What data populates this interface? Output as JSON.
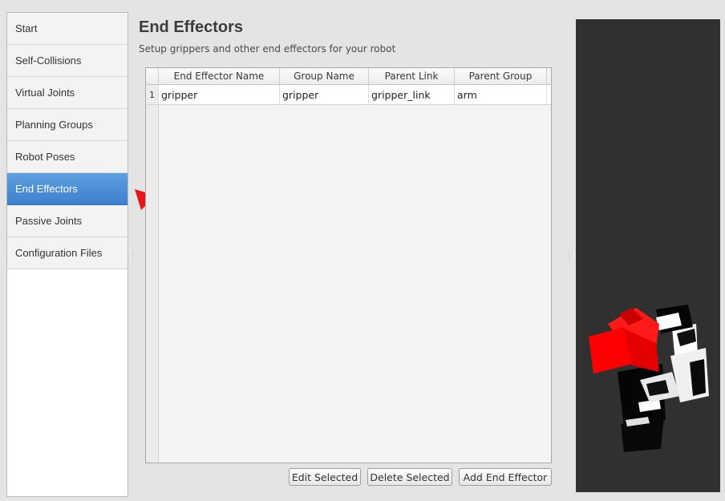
{
  "sidebar": {
    "items": [
      {
        "label": "Start"
      },
      {
        "label": "Self-Collisions"
      },
      {
        "label": "Virtual Joints"
      },
      {
        "label": "Planning Groups"
      },
      {
        "label": "Robot Poses"
      },
      {
        "label": "End Effectors",
        "active": true
      },
      {
        "label": "Passive Joints"
      },
      {
        "label": "Configuration Files"
      }
    ]
  },
  "main": {
    "title": "End Effectors",
    "subtitle": "Setup grippers and other end effectors for your robot",
    "table": {
      "columns": [
        "End Effector Name",
        "Group Name",
        "Parent Link",
        "Parent Group"
      ],
      "rows": [
        {
          "num": "1",
          "cells": [
            "gripper",
            "gripper",
            "gripper_link",
            "arm"
          ]
        }
      ]
    },
    "buttons": {
      "edit": "Edit Selected",
      "delete": "Delete Selected",
      "add": "Add End Effector"
    }
  },
  "colors": {
    "active_item": "#4a8ad6",
    "arrow": "#e8161b",
    "viewer_bg": "#303030",
    "robot_red": "#ff0000"
  }
}
